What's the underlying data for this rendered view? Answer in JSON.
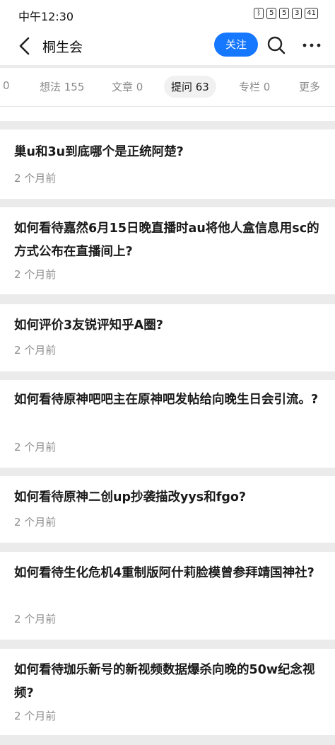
{
  "status": {
    "time": "中午12:30",
    "icons": [
      "ᛒ",
      "5",
      "5",
      "3",
      "41"
    ]
  },
  "appbar": {
    "title": "桐生会",
    "follow_label": "关注"
  },
  "tabs": [
    {
      "label": "0"
    },
    {
      "label": "想法 155"
    },
    {
      "label": "文章 0"
    },
    {
      "label": "提问 63"
    },
    {
      "label": "专栏 0"
    },
    {
      "label": "更多"
    }
  ],
  "questions": [
    {
      "title": "巢u和3u到底哪个是正统阿楚?",
      "time": "2 个月前"
    },
    {
      "title": "如何看待嘉然6月15日晚直播时au将他人盒信息用sc的方式公布在直播间上?",
      "time": "2 个月前"
    },
    {
      "title": "如何评价3友锐评知乎A圈?",
      "time": "2 个月前"
    },
    {
      "title": "如何看待原神吧吧主在原神吧发帖给向晚生日会引流。?",
      "time": "2 个月前"
    },
    {
      "title": "如何看待原神二创up抄袭描改yys和fgo?",
      "time": "2 个月前"
    },
    {
      "title": "如何看待生化危机4重制版阿什莉脸模曾参拜靖国神社?",
      "time": "2 个月前"
    },
    {
      "title": "如何看待珈乐新号的新视频数据爆杀向晚的50w纪念视频?",
      "time": "2 个月前"
    }
  ]
}
